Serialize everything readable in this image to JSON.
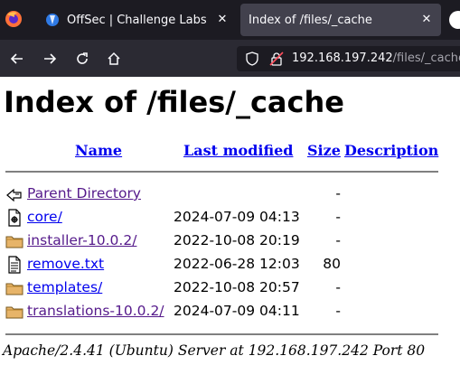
{
  "browser": {
    "tabs": [
      {
        "title": "OffSec | Challenge Labs",
        "active": false
      },
      {
        "title": "Index of /files/_cache",
        "active": true
      }
    ],
    "url": {
      "host": "192.168.197.242",
      "path": "/files/_cache/"
    }
  },
  "page": {
    "heading": "Index of /files/_cache",
    "columns": {
      "name": "Name",
      "modified": "Last modified",
      "size": "Size",
      "description": "Description"
    },
    "entries": [
      {
        "name": "Parent Directory",
        "modified": "",
        "size": "-",
        "icon": "back-icon",
        "visited": true
      },
      {
        "name": "core/",
        "modified": "2024-07-09 04:13",
        "size": "-",
        "icon": "file-binary-icon",
        "visited": false
      },
      {
        "name": "installer-10.0.2/",
        "modified": "2022-10-08 20:19",
        "size": "-",
        "icon": "folder-icon",
        "visited": true
      },
      {
        "name": "remove.txt",
        "modified": "2022-06-28 12:03",
        "size": "80",
        "icon": "text-file-icon",
        "visited": false
      },
      {
        "name": "templates/",
        "modified": "2022-10-08 20:57",
        "size": "-",
        "icon": "folder-icon",
        "visited": false
      },
      {
        "name": "translations-10.0.2/",
        "modified": "2024-07-09 04:11",
        "size": "-",
        "icon": "folder-icon",
        "visited": true
      }
    ],
    "footer": "Apache/2.4.41 (Ubuntu) Server at 192.168.197.242 Port 80"
  }
}
